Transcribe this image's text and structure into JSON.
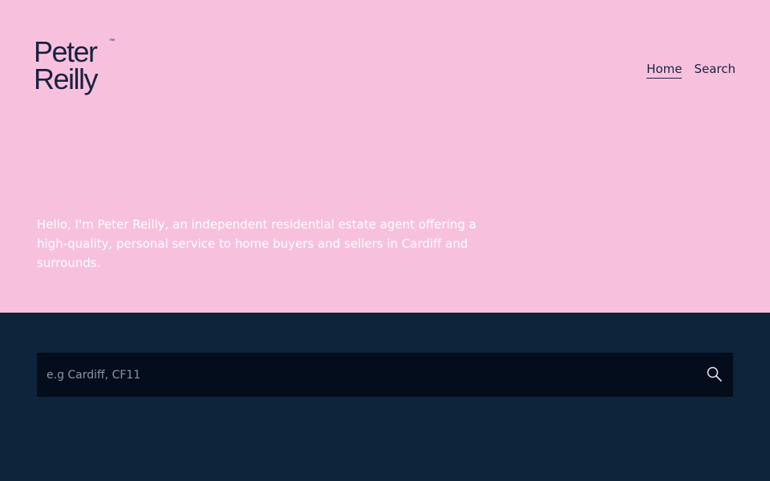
{
  "header": {
    "logo": {
      "line1": "Peter",
      "line2": "Reilly",
      "trademark": "™"
    },
    "nav": {
      "home_label": "Home",
      "search_label": "Search"
    }
  },
  "hero": {
    "intro_text": "Hello, I'm Peter Reilly, an independent residential estate agent offering a high-quality, personal service to home buyers and sellers in Cardiff and surrounds."
  },
  "search": {
    "placeholder": "e.g Cardiff, CF11",
    "value": "",
    "icon": "search-icon"
  },
  "colors": {
    "hero_background": "#f7c1dd",
    "search_section_background": "#0e243a",
    "search_box_background": "#030d1c",
    "brand_navy": "#1b2140"
  }
}
